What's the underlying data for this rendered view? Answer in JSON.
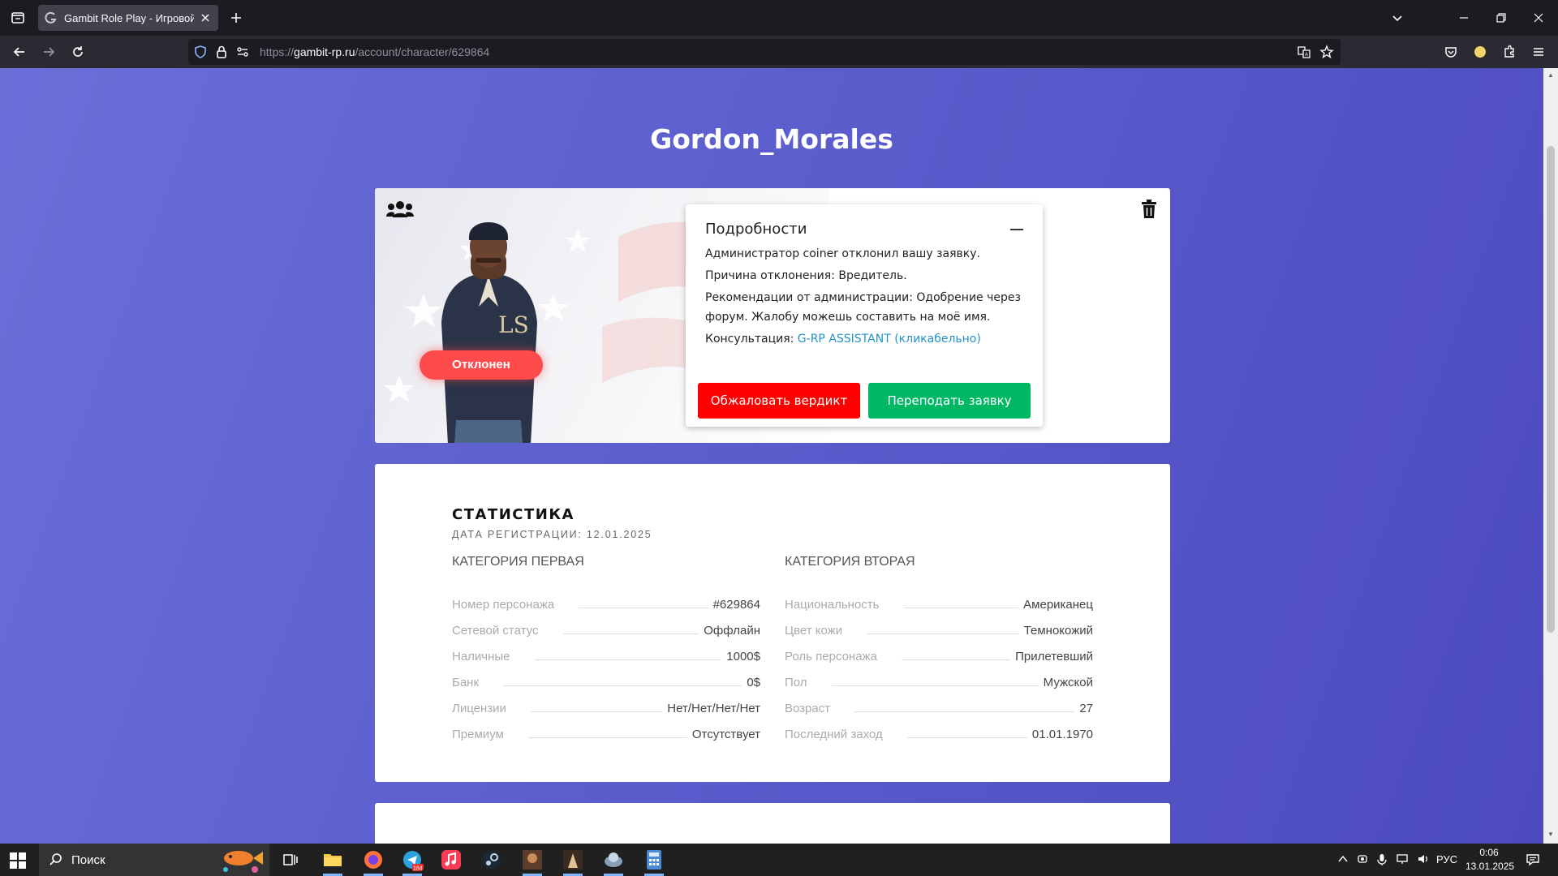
{
  "browser": {
    "tab_title": "Gambit Role Play - Игровой пр",
    "url_host": "gambit-rp.ru",
    "url_prefix": "https://",
    "url_path": "/account/character/629864"
  },
  "page": {
    "character_name": "Gordon_Morales",
    "status_badge": "Отклонен",
    "details": {
      "title": "Подробности",
      "line1": "Администратор coiner отклонил вашу заявку.",
      "line2": "Причина отклонения: Вредитель.",
      "line3": "Рекомендации от администрации: Одобрение через форум. Жалобу можешь составить на моё имя.",
      "line4_label": "Консультация: ",
      "line4_link": "G-RP ASSISTANT (кликабельно)",
      "appeal_button": "Обжаловать вердикт",
      "resubmit_button": "Переподать заявку"
    },
    "stats": {
      "title": "СТАТИСТИКА",
      "reg_date": "ДАТА РЕГИСТРАЦИИ: 12.01.2025",
      "cat1_title": "КАТЕГОРИЯ ПЕРВАЯ",
      "cat2_title": "КАТЕГОРИЯ ВТОРАЯ",
      "cat1": [
        {
          "k": "Номер персонажа",
          "v": "#629864"
        },
        {
          "k": "Сетевой статус",
          "v": "Оффлайн"
        },
        {
          "k": "Наличные",
          "v": "1000$"
        },
        {
          "k": "Банк",
          "v": "0$"
        },
        {
          "k": "Лицензии",
          "v": "Нет/Нет/Нет/Нет"
        },
        {
          "k": "Премиум",
          "v": "Отсутствует"
        }
      ],
      "cat2": [
        {
          "k": "Национальность",
          "v": "Американец"
        },
        {
          "k": "Цвет кожи",
          "v": "Темнокожий"
        },
        {
          "k": "Роль персонажа",
          "v": "Прилетевший"
        },
        {
          "k": "Пол",
          "v": "Мужской"
        },
        {
          "k": "Возраст",
          "v": "27"
        },
        {
          "k": "Последний заход",
          "v": "01.01.1970"
        }
      ]
    }
  },
  "taskbar": {
    "search_label": "Поиск",
    "telegram_badge": "164",
    "lang": "РУС",
    "time": "0:06",
    "date": "13.01.2025"
  },
  "colors": {
    "page_gradient_start": "#6a6fd8",
    "page_gradient_end": "#4d4ac0",
    "reject_red": "#ff0000",
    "resubmit_green": "#00b863",
    "badge_red": "#ff4b4b",
    "link_blue": "#2493c7"
  }
}
